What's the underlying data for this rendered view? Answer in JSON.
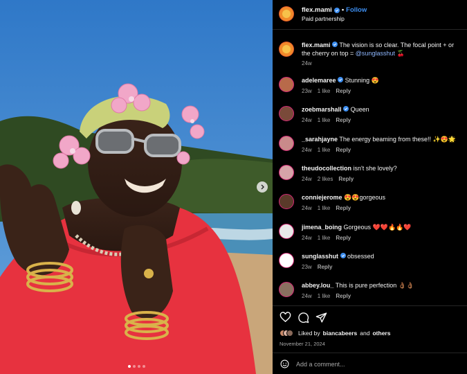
{
  "post": {
    "images_count": 4,
    "active_image": 1
  },
  "header": {
    "username": "flex.mami",
    "bullet": "•",
    "follow_label": "Follow",
    "subtitle": "Paid partnership"
  },
  "caption": {
    "username": "flex.mami",
    "text": "The vision is so clear. The focal point + or the cherry on top = ",
    "mention": "@sunglasshut",
    "emoji": "🍒",
    "time": "24w"
  },
  "comments": [
    {
      "username": "adelemaree",
      "verified": true,
      "text": "Stunning 😍",
      "time": "23w",
      "likes": "1 like",
      "reply": "Reply",
      "avatar_color": "#b86a4a"
    },
    {
      "username": "zoebmarshall",
      "verified": true,
      "text": "Queen",
      "time": "24w",
      "likes": "1 like",
      "reply": "Reply",
      "avatar_color": "#7a4a3a"
    },
    {
      "username": "_sarahjayne",
      "verified": false,
      "text": "The energy beaming from these!! ✨😍🌟",
      "time": "24w",
      "likes": "1 like",
      "reply": "Reply",
      "avatar_color": "#c98a8a"
    },
    {
      "username": "theudocollection",
      "verified": false,
      "text": "isn't she lovely?",
      "time": "24w",
      "likes": "2 likes",
      "reply": "Reply",
      "avatar_color": "#d6a3a8"
    },
    {
      "username": "conniejerome",
      "verified": false,
      "text": "😍😍gorgeous",
      "time": "24w",
      "likes": "1 like",
      "reply": "Reply",
      "avatar_color": "#5a3a2a"
    },
    {
      "username": "jimena_boing",
      "verified": false,
      "text": "Gorgeous ❤️❤️🔥🔥❤️",
      "time": "24w",
      "likes": "1 like",
      "reply": "Reply",
      "avatar_color": "#e8e8e8"
    },
    {
      "username": "sunglasshut",
      "verified": true,
      "text": "obsessed",
      "time": "23w",
      "likes": "",
      "reply": "Reply",
      "avatar_color": "#ffffff"
    },
    {
      "username": "abbey.lou_",
      "verified": false,
      "text": "This is pure perfection 👌🏾👌🏾",
      "time": "24w",
      "likes": "1 like",
      "reply": "Reply",
      "avatar_color": "#8a7060"
    }
  ],
  "actions": {
    "liked_by_prefix": "Liked by",
    "liked_by_user": "biancabeers",
    "liked_by_and": "and",
    "liked_by_others": "others",
    "date": "November 21, 2024"
  },
  "add_comment": {
    "placeholder": "Add a comment..."
  },
  "icons": {
    "like": "heart-icon",
    "comment": "comment-bubble-icon",
    "share": "paper-plane-icon",
    "emoji": "smiley-icon",
    "next": "chevron-right-icon",
    "verified": "verified-badge-icon"
  },
  "colors": {
    "background": "#000000",
    "text": "#f5f5f5",
    "muted": "#a8a8a8",
    "link": "#3d8ef0",
    "verified": "#3d8ef0"
  }
}
